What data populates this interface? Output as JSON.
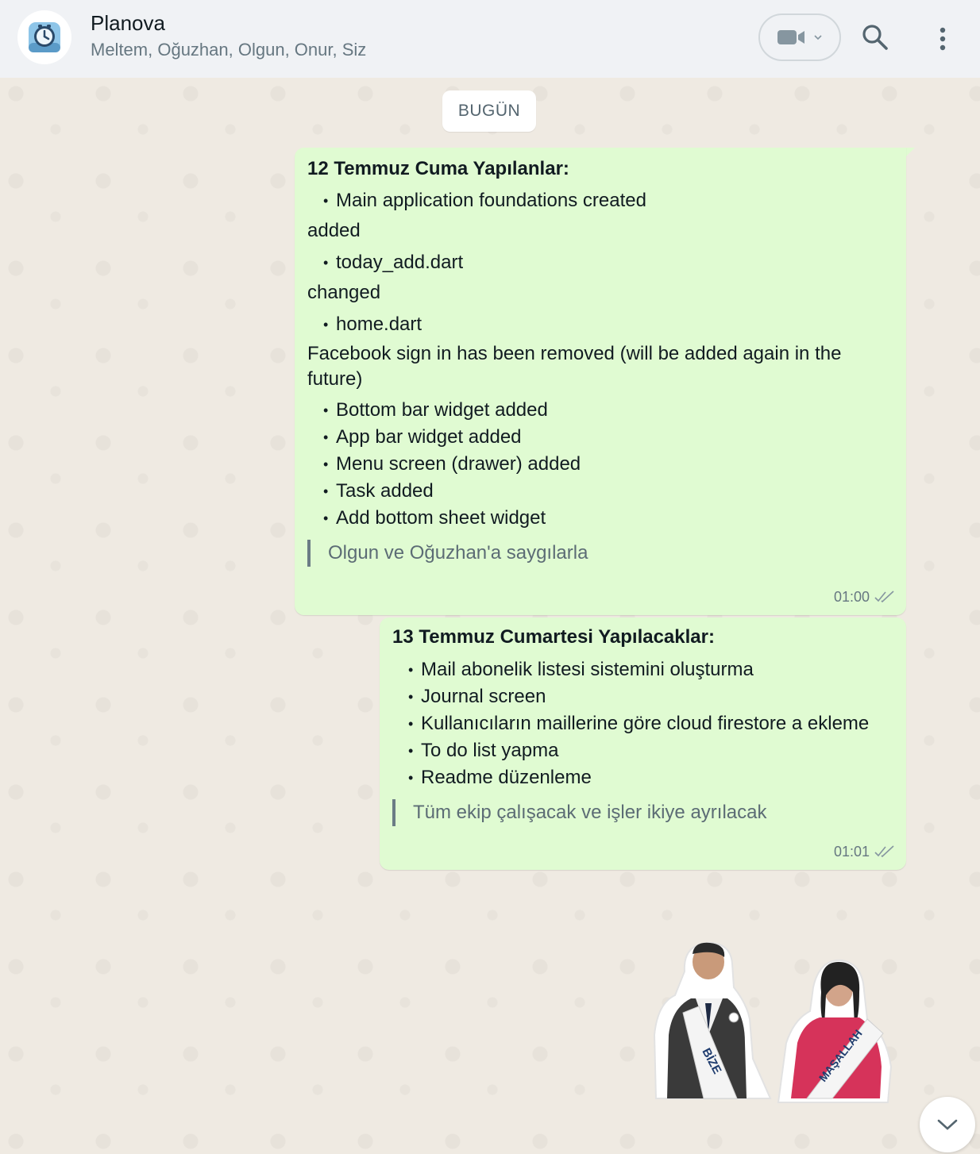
{
  "header": {
    "title": "Planova",
    "subtitle": "Meltem, Oğuzhan, Olgun, Onur, Siz"
  },
  "date_chip": "BUGÜN",
  "messages": [
    {
      "lines": {
        "title": "12 Temmuz Cuma Yapılanlar:",
        "b1": "Main application foundations created",
        "h_added": "added",
        "b2": "today_add.dart",
        "h_changed": "changed",
        "b3": "home.dart",
        "para": "Facebook sign in has been removed (will be added again in the future)",
        "b4": "Bottom bar widget added",
        "b5": "App bar widget added",
        "b6": "Menu screen (drawer) added",
        "b7": "Task added",
        "b8": "Add bottom sheet widget",
        "quote": "Olgun ve Oğuzhan'a saygılarla"
      },
      "time": "01:00"
    },
    {
      "lines": {
        "title": "13 Temmuz Cumartesi Yapılacaklar:",
        "b1": "Mail abonelik listesi sistemini oluşturma",
        "b2": "Journal screen",
        "b3": "Kullanıcıların maillerine göre cloud firestore a ekleme",
        "b4": "To do list yapma",
        "b5": "Readme düzenleme",
        "quote": "Tüm ekip çalışacak ve işler ikiye ayrılacak"
      },
      "time": "01:01"
    }
  ],
  "sticker": {
    "left_sash": "BİZE",
    "right_sash": "MAŞALLAH"
  },
  "bullet_char": "•",
  "colors": {
    "header_bg": "#f0f2f5",
    "chat_bg": "#efeae2",
    "bubble_out": "#e0fbd2",
    "tick": "#8696a0"
  }
}
